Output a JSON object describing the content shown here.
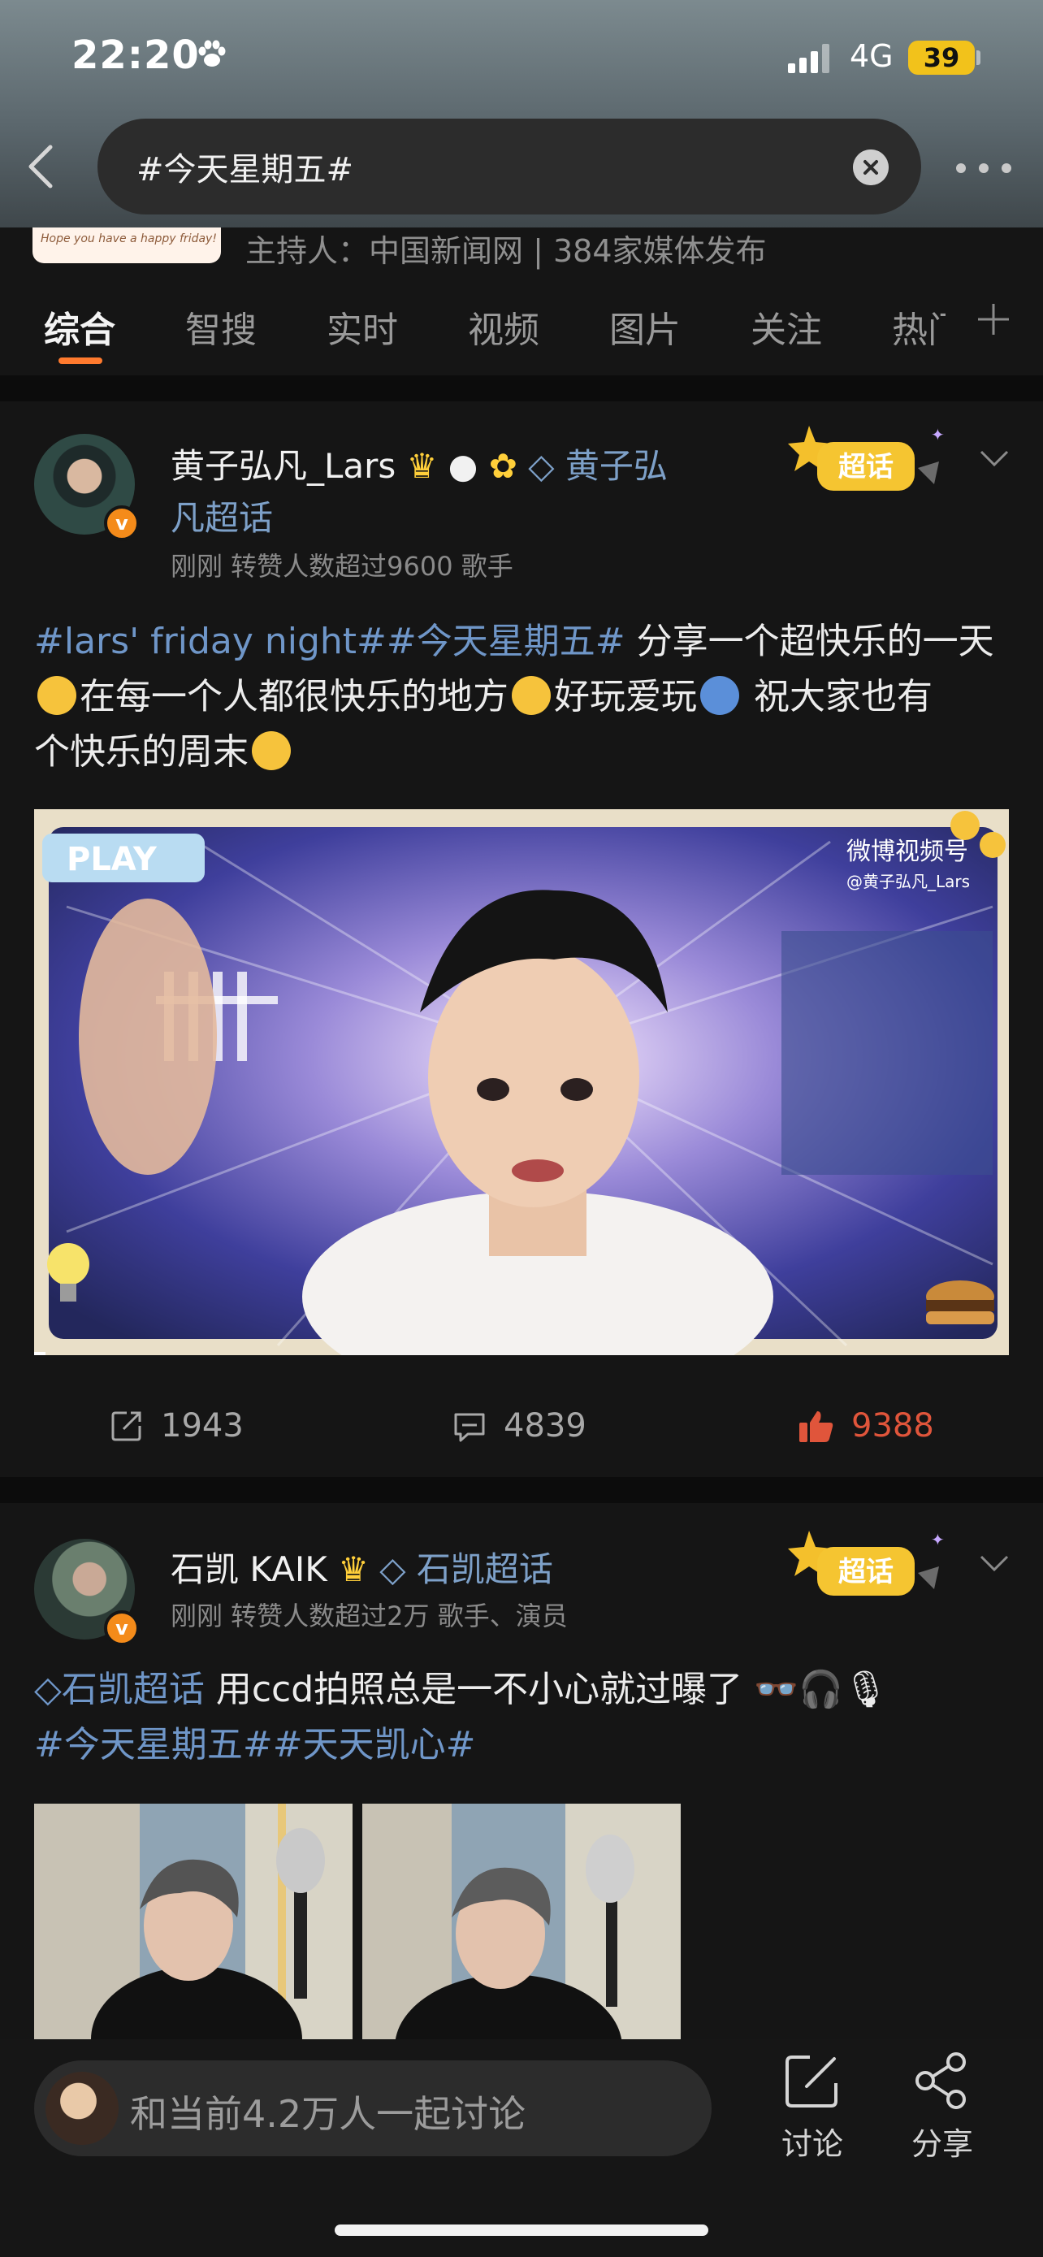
{
  "status_bar": {
    "time": "22:20",
    "network": "4G",
    "battery": "39"
  },
  "search": {
    "query": "#今天星期五#"
  },
  "topic": {
    "banner_text": "Hope you have a happy friday!",
    "host_line": "主持人：中国新闻网 | 384家媒体发布"
  },
  "tabs": [
    "综合",
    "智搜",
    "实时",
    "视频",
    "图片",
    "关注",
    "热门"
  ],
  "posts": [
    {
      "username": "黄子弘凡_Lars",
      "supertopic_line1": "黄子弘",
      "supertopic_line2": "凡超话",
      "badge": "超话",
      "meta": "刚刚 转赞人数超过9600  歌手",
      "text_parts": {
        "t1": "#lars' friday night##今天星期五#",
        "t2": " 分享一个超快乐的一天",
        "t3": "在每一个人都很快乐的地方",
        "t4": "好玩爱玩",
        "t5": " 祝大家也有",
        "t6": "个快乐的周末"
      },
      "video": {
        "play_label": "PLAY",
        "watermark": "微博视频号",
        "watermark_handle": "@黄子弘凡_Lars"
      },
      "reposts": "1943",
      "comments": "4839",
      "likes": "9388"
    },
    {
      "username": "石凯 KAIK",
      "supertopic": "石凯超话",
      "badge": "超话",
      "meta": "刚刚 转赞人数超过2万  歌手、演员",
      "text_parts": {
        "t1": "石凯超话",
        "t2": " 用ccd拍照总是一不小心就过曝了",
        "t3": "#今天星期五##天天凯心#"
      }
    }
  ],
  "bottom": {
    "discuss_placeholder": "和当前4.2万人一起讨论",
    "discuss_label": "讨论",
    "share_label": "分享"
  },
  "colors": {
    "accent": "#ff7a2e",
    "link": "#6f96c8",
    "like_red": "#e0553b",
    "gold": "#ffcf3a"
  }
}
